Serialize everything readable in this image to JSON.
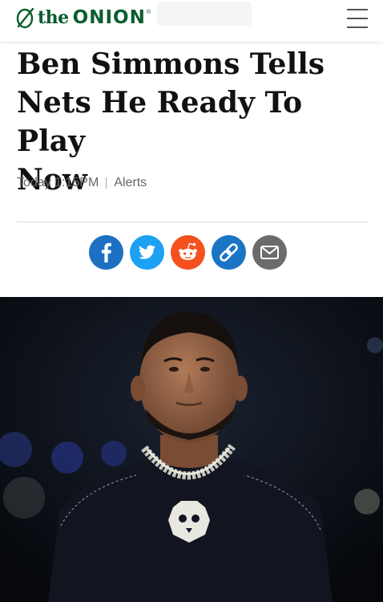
{
  "header": {
    "logo_prefix": "the",
    "logo_name": "ONION",
    "logo_mark": "®",
    "menu_icon": "hamburger-menu-icon"
  },
  "article": {
    "title_lines": [
      "Ben Simmons Tells",
      "Nets He Ready To Play",
      "Now"
    ],
    "time": "Today 1:15PM",
    "category": "Alerts"
  },
  "share": [
    {
      "icon": "facebook-icon",
      "color": "#1d70c2"
    },
    {
      "icon": "twitter-icon",
      "color": "#1da1f2"
    },
    {
      "icon": "reddit-icon",
      "color": "#f4511e"
    },
    {
      "icon": "link-icon",
      "color": "#1b74c4"
    },
    {
      "icon": "email-icon",
      "color": "#6b6b6b"
    }
  ],
  "colors": {
    "brand": "#0a5d2d",
    "title": "#111111",
    "meta": "#666666"
  }
}
